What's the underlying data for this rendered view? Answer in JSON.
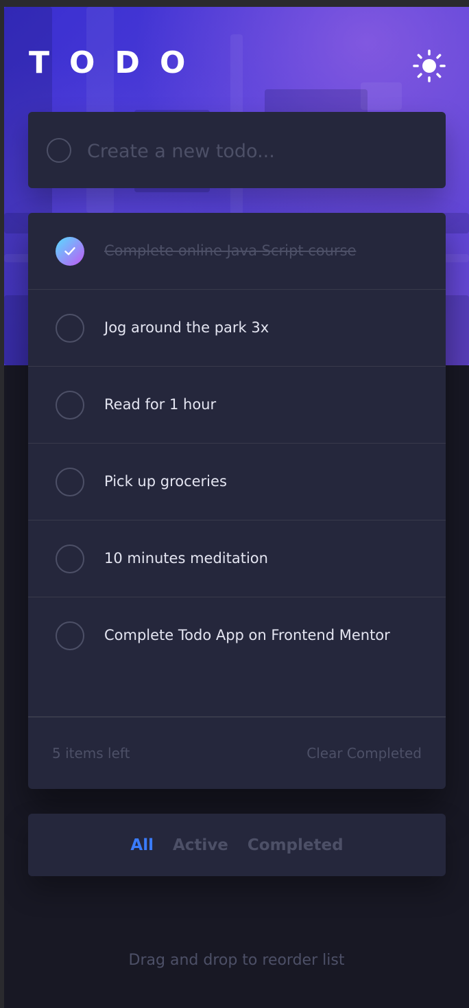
{
  "app": {
    "title": "TODO",
    "theme_toggle_icon": "sun-icon"
  },
  "create": {
    "placeholder": "Create a new todo..."
  },
  "todos": [
    {
      "text": "Complete online Java Script course",
      "completed": true
    },
    {
      "text": "Jog around the park 3x",
      "completed": false
    },
    {
      "text": "Read for 1 hour",
      "completed": false
    },
    {
      "text": "Pick up groceries",
      "completed": false
    },
    {
      "text": "10 minutes meditation",
      "completed": false
    },
    {
      "text": "Complete Todo App on Frontend Mentor",
      "completed": false
    }
  ],
  "footer": {
    "items_left": "5 items left",
    "clear_completed": "Clear Completed"
  },
  "filters": {
    "all": "All",
    "active": "Active",
    "completed": "Completed",
    "selected": "all"
  },
  "hint": "Drag and drop to reorder list",
  "colors": {
    "accent": "#3a7cfd",
    "check_gradient_start": "#57ddff",
    "check_gradient_end": "#c058f3",
    "card_bg": "#25273c",
    "page_bg": "#181824",
    "muted_text": "#4d5067",
    "item_text": "#e4e5f1"
  }
}
